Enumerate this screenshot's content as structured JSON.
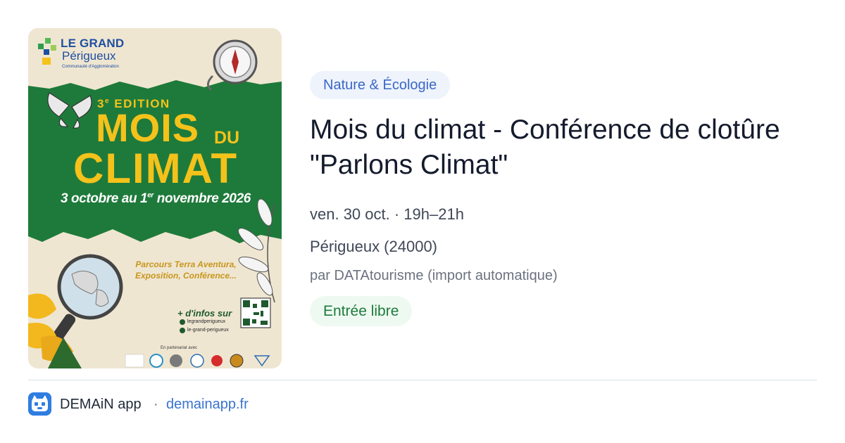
{
  "poster": {
    "logo_top": "LE GRAND",
    "logo_bottom": "Périgueux",
    "logo_sub": "Communauté d'Agglomération",
    "edition_number": "3",
    "edition_suffix": "e",
    "edition_word": " EDITION",
    "title_line1": "MOIS",
    "title_du": "DU",
    "title_line2": "CLIMAT",
    "dates_start": "3 octobre au 1",
    "dates_sup": "er",
    "dates_end": " novembre 2026",
    "activities_line1": "Parcours Terra Aventura,",
    "activities_line2": "Exposition, Conférence...",
    "infos": "+ d'infos sur",
    "social_facebook": "legrandperigueux",
    "social_instagram": "le-grand-perigueux",
    "partners_label": "En partenariat avec",
    "colors": {
      "green": "#1e7a3a",
      "yellow": "#f4c21b",
      "paper": "#efe6d2"
    }
  },
  "event": {
    "category": "Nature & Écologie",
    "title": "Mois du climat - Conférence de clotûre \"Parlons Climat\"",
    "datetime": "ven. 30 oct. · 19h–21h",
    "location": "Périgueux (24000)",
    "source": "par DATAtourisme (import automatique)",
    "price": "Entrée libre"
  },
  "footer": {
    "app_icon": "demain-app-icon",
    "app_name": "DEMAiN app",
    "separator": "·",
    "link": "demainapp.fr"
  }
}
